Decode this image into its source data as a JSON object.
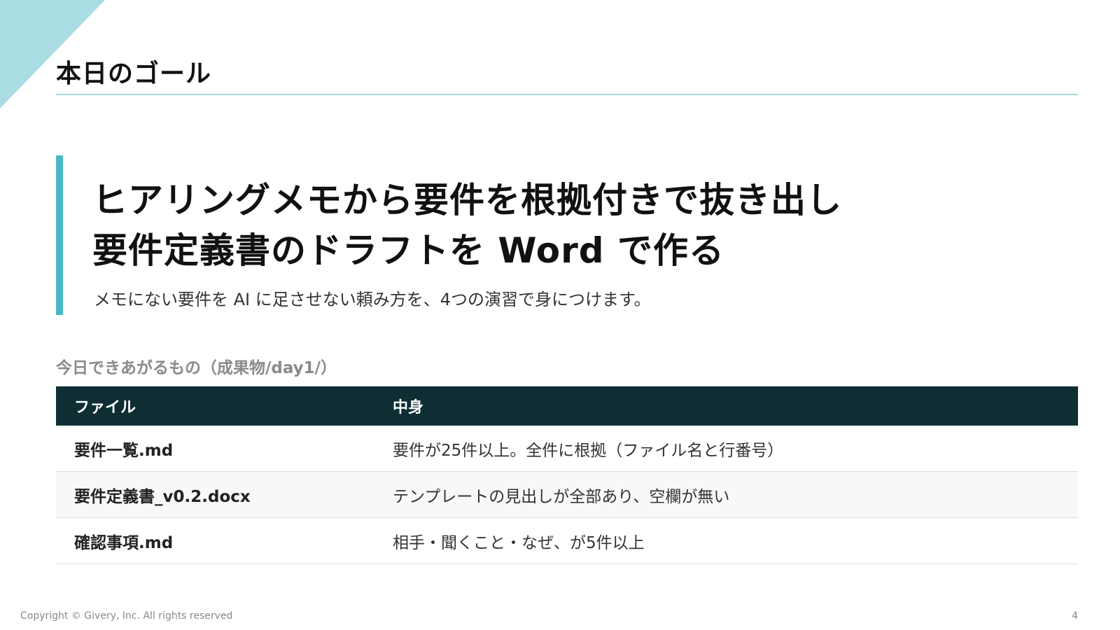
{
  "slide": {
    "title": "本日のゴール",
    "goal": {
      "line1": "ヒアリングメモから要件を根拠付きで抜き出し",
      "line2": "要件定義書のドラフトを Word で作る",
      "subtitle": "メモにない要件を AI に足させない頼み方を、4つの演習で身につけます。"
    },
    "deliverables": {
      "label": "今日できあがるもの（成果物/day1/）",
      "headers": {
        "file": "ファイル",
        "content": "中身"
      },
      "rows": [
        {
          "file": "要件一覧.md",
          "content": "要件が25件以上。全件に根拠（ファイル名と行番号）"
        },
        {
          "file": "要件定義書_v0.2.docx",
          "content": "テンプレートの見出しが全部あり、空欄が無い"
        },
        {
          "file": "確認事項.md",
          "content": "相手・聞くこと・なぜ、が5件以上"
        }
      ]
    }
  },
  "footer": {
    "copyright": "Copyright © Givery, Inc. All rights reserved",
    "page_number": "4"
  },
  "colors": {
    "accent_bar": "#4bb8c6",
    "corner_triangle": "#a9dde3",
    "title_rule": "#a9d6e3",
    "table_header_bg": "#0e2e33"
  }
}
